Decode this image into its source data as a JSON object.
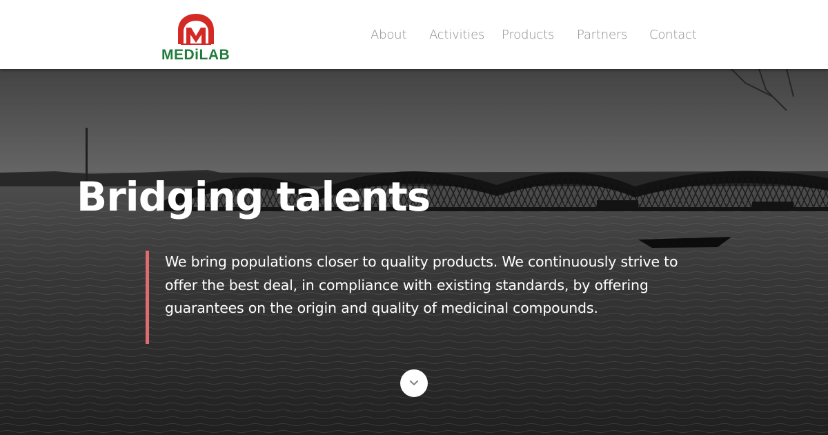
{
  "brand": {
    "name": "MEDiLAB",
    "colors": {
      "red": "#d42a26",
      "green": "#1f7a3c"
    }
  },
  "nav": {
    "items": [
      "About",
      "Activities",
      "Products",
      "Partners",
      "Contact"
    ]
  },
  "hero": {
    "title": "Bridging talents",
    "description": "We bring populations closer to quality products. We continuously strive to offer the best deal, in compliance with existing standards, by offering guarantees on the origin and quality of medicinal compounds.",
    "accent_color": "#e06b70",
    "scroll_icon": "chevron-down-icon"
  }
}
